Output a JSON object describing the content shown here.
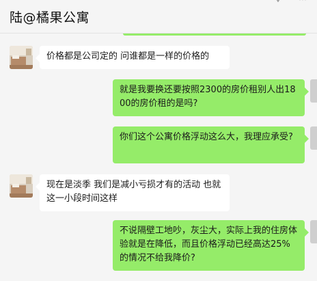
{
  "header": {
    "title": "陆@橘果公寓"
  },
  "messages": [
    {
      "side": "left",
      "text": "价格都是公司定的 问谁都是一样的价格的"
    },
    {
      "side": "right",
      "text": "就是我要换还要按照2300的房价租别人出1800的房价租的是吗?"
    },
    {
      "side": "right",
      "text": "你们这个公寓价格浮动这么大，我理应承受?"
    },
    {
      "side": "left",
      "text": "现在是淡季 我们是减小亏损才有的活动 也就这一小段时间这样"
    },
    {
      "side": "right",
      "text": "不说隔壁工地吵，灰尘大，实际上我的住房体验就是在降低，而且价格浮动已经高达25%的情况不给我降价?"
    }
  ]
}
